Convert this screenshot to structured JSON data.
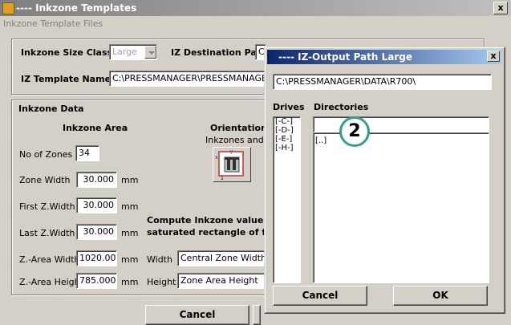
{
  "window": {
    "title": "---- Inkzone Templates",
    "menu": "Inkzone Template Files",
    "close": "x"
  },
  "top": {
    "size_class_label": "Inkzone Size Class",
    "size_class_value": "Large",
    "dest_path_label": "IZ Destination Path",
    "dest_path_value": "C",
    "template_name_label": "IZ Template Name",
    "template_name_value": "C:\\PRESSMANAGER\\PRESSMANAGERS"
  },
  "inkzone": {
    "section_label": "Inkzone Data",
    "area_label": "Inkzone Area",
    "orientation_label": "Orientation",
    "orientation_sub": "Inkzones and Thumb",
    "rows": [
      {
        "label": "No of Zones",
        "value": "34",
        "unit": ""
      },
      {
        "label": "Zone Width",
        "value": "30.000",
        "unit": "mm"
      },
      {
        "label": "First Z.Width",
        "value": "30.000",
        "unit": "mm"
      },
      {
        "label": "Last Z.Width",
        "value": "30.000",
        "unit": "mm"
      },
      {
        "label": "Z.-Area Width",
        "value": "1020.000",
        "unit": "mm"
      },
      {
        "label": "Z.-Area Height",
        "value": "785.000",
        "unit": "mm"
      }
    ],
    "compute_line1": "Compute Inkzone values re",
    "compute_line2": "saturated rectangle of follo",
    "width_label": "Width",
    "width_value": "Central Zone Width",
    "height_label": "Height",
    "height_value": "Zone Area Height"
  },
  "buttons": {
    "cancel": "Cancel"
  },
  "dialog": {
    "title": "---- IZ-Output Path Large",
    "close": "x",
    "path_value": "C:\\PRESSMANAGER\\DATA\\R700\\",
    "drives_label": "Drives",
    "directories_label": "Directories",
    "drives": [
      "[-C-]",
      "[-D-]",
      "[-E-]",
      "[-H-]"
    ],
    "directories": [
      "[..]"
    ],
    "cancel": "Cancel",
    "ok": "OK"
  },
  "annotation": {
    "step": "2",
    "color": "#2f9e8f"
  }
}
